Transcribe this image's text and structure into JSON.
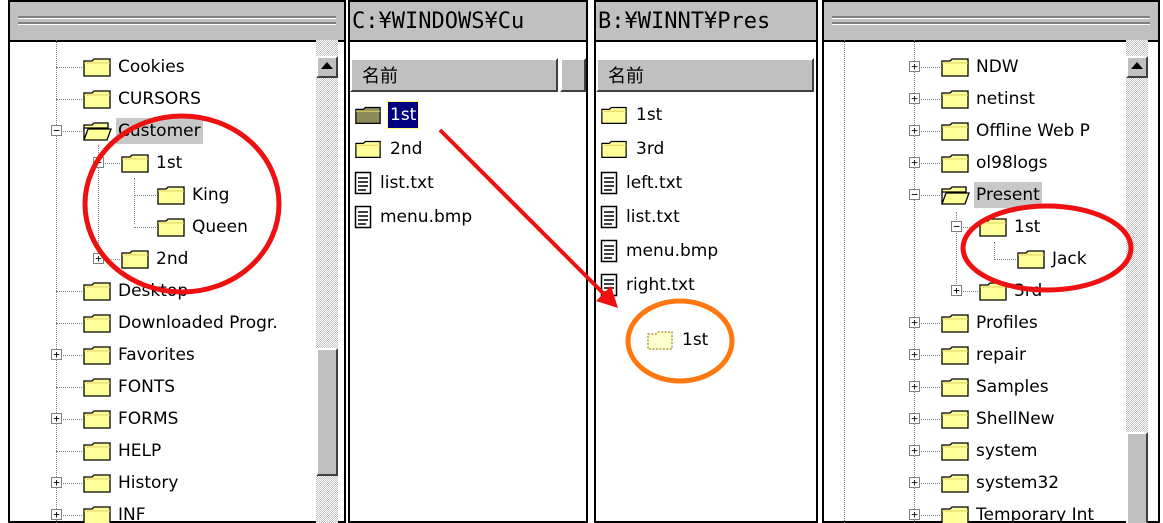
{
  "left_tree": {
    "items": [
      {
        "label": "Cookies"
      },
      {
        "label": "CURSORS"
      },
      {
        "label": "Customer"
      },
      {
        "label": "1st"
      },
      {
        "label": "King"
      },
      {
        "label": "Queen"
      },
      {
        "label": "2nd"
      },
      {
        "label": "Desktop"
      },
      {
        "label": "Downloaded Progr."
      },
      {
        "label": "Favorites"
      },
      {
        "label": "FONTS"
      },
      {
        "label": "FORMS"
      },
      {
        "label": "HELP"
      },
      {
        "label": "History"
      },
      {
        "label": "INF"
      }
    ]
  },
  "middle_left": {
    "path": "C:¥WINDOWS¥Cu",
    "column_header": "名前",
    "files": [
      {
        "label": "1st",
        "kind": "folder",
        "selected": true
      },
      {
        "label": "2nd",
        "kind": "folder"
      },
      {
        "label": "list.txt",
        "kind": "document"
      },
      {
        "label": "menu.bmp",
        "kind": "document"
      }
    ]
  },
  "middle_right": {
    "path": "B:¥WINNT¥Pres",
    "column_header": "名前",
    "files": [
      {
        "label": "1st",
        "kind": "folder"
      },
      {
        "label": "3rd",
        "kind": "folder"
      },
      {
        "label": "left.txt",
        "kind": "document"
      },
      {
        "label": "list.txt",
        "kind": "document"
      },
      {
        "label": "menu.bmp",
        "kind": "document"
      },
      {
        "label": "right.txt",
        "kind": "document"
      }
    ],
    "dropped_item": {
      "label": "1st"
    }
  },
  "right_tree": {
    "items": [
      {
        "label": "NDW"
      },
      {
        "label": "netinst"
      },
      {
        "label": "Offline Web P"
      },
      {
        "label": "ol98logs"
      },
      {
        "label": "Present"
      },
      {
        "label": "1st"
      },
      {
        "label": "Jack"
      },
      {
        "label": "3rd"
      },
      {
        "label": "Profiles"
      },
      {
        "label": "repair"
      },
      {
        "label": "Samples"
      },
      {
        "label": "ShellNew"
      },
      {
        "label": "system"
      },
      {
        "label": "system32"
      },
      {
        "label": "Temporary Int"
      }
    ]
  },
  "annotation_colors": {
    "red": "#ee1111",
    "orange": "#ff7711",
    "folder_yellow": "#ffff99",
    "folder_border": "#000000",
    "selection_navy": "#000080"
  }
}
